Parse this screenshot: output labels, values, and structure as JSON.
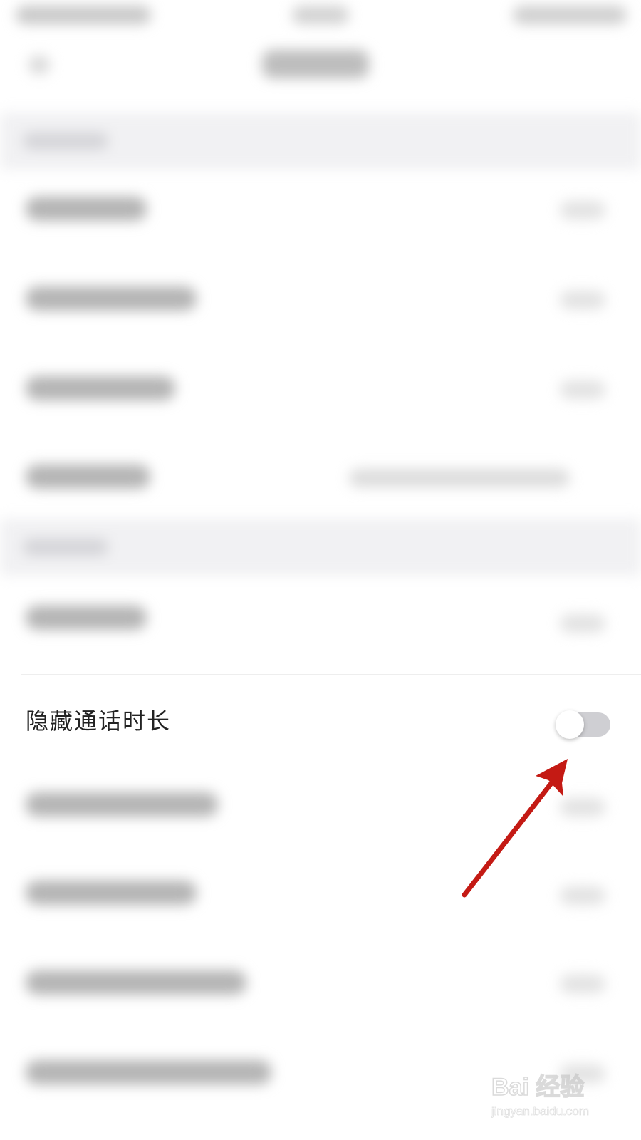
{
  "settings": {
    "hide_call_duration": {
      "label": "隐藏通话时长",
      "enabled": false
    }
  },
  "colors": {
    "toggle_track_off": "#cfcfd3",
    "toggle_knob": "#ffffff",
    "annotation_arrow": "#c41a14",
    "section_background": "#f1f1f3"
  },
  "annotation": {
    "icon": "arrow-pointing-at-toggle"
  },
  "watermark": {
    "logo_text": "Bai 经验",
    "url": "jingyan.baidu.com"
  }
}
